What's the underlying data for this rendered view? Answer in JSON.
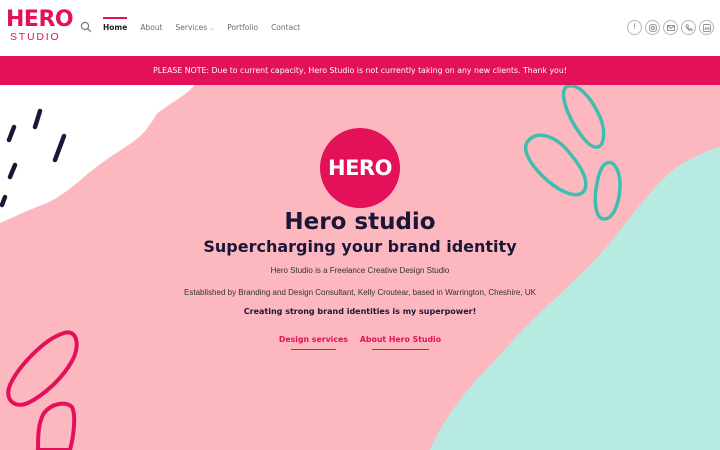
{
  "header": {
    "logo_top": "HERO",
    "logo_bottom": "STUDIO",
    "search_icon": "search-icon",
    "nav": [
      {
        "label": "Home",
        "active": true
      },
      {
        "label": "About"
      },
      {
        "label": "Services",
        "has_dropdown": true
      },
      {
        "label": "Portfolio"
      },
      {
        "label": "Contact"
      }
    ],
    "socials": [
      "facebook-icon",
      "instagram-icon",
      "email-icon",
      "phone-icon",
      "linkedin-icon"
    ]
  },
  "notice": {
    "text": "PLEASE NOTE: Due to current capacity, Hero Studio is not currently taking on any new clients. Thank you!"
  },
  "hero": {
    "logo_text": "HERO",
    "title": "Hero studio",
    "subtitle": "Supercharging your brand identity",
    "paragraph_1": "Hero Studio is a Freelance Creative Design Studio",
    "paragraph_2": "Established by Branding and Design Consultant, Kelly Croutear, based in Warrington, Cheshire, UK",
    "tagline": "Creating strong brand identities is my superpower!",
    "buttons": [
      {
        "label": "Design services"
      },
      {
        "label": "About Hero Studio"
      }
    ]
  },
  "colors": {
    "brand": "#e3105a",
    "background_pink": "#fdb7be",
    "mint": "#b7ebe2",
    "teal_outline": "#3cbfae",
    "navy": "#1b1638"
  }
}
